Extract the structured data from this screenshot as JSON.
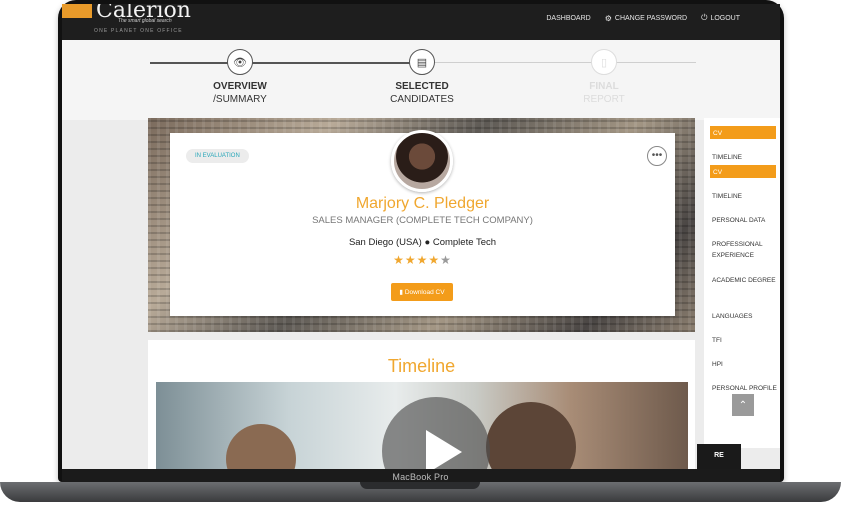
{
  "brand": {
    "logo_text": "Calerion",
    "tagline": "The smart global search",
    "subline": "ONE PLANET ONE OFFICE",
    "accent_color": "#f39c1a"
  },
  "nav": {
    "dashboard": "DASHBOARD",
    "change_password": "CHANGE PASSWORD",
    "logout": "LOGOUT"
  },
  "steps": [
    {
      "title": "OVERVIEW",
      "sub": "/SUMMARY",
      "icon": "eye-icon",
      "state": "done"
    },
    {
      "title": "SELECTED",
      "sub": "CANDIDATES",
      "icon": "list-icon",
      "state": "current"
    },
    {
      "title": "FINAL",
      "sub": "REPORT",
      "icon": "document-icon",
      "state": "pending"
    }
  ],
  "candidate": {
    "status": "IN EVALUATION",
    "name": "Marjory C. Pledger",
    "role": "SALES MANAGER (COMPLETE TECH COMPANY)",
    "location": "San Diego (USA)",
    "company": "Complete Tech",
    "rating": 4,
    "rating_max": 5,
    "download_label": "Download CV"
  },
  "side_nav": {
    "items": [
      {
        "label": "CV",
        "active": true
      },
      {
        "label": "TIMELINE",
        "active": false
      },
      {
        "label": "CV",
        "active": true
      },
      {
        "label": "TIMELINE",
        "active": false
      },
      {
        "label": "PERSONAL DATA",
        "active": false
      },
      {
        "label": "PROFESSIONAL EXPERIENCE",
        "active": false
      },
      {
        "label": "ACADEMIC DEGREE",
        "active": false
      },
      {
        "label": "LANGUAGES",
        "active": false
      },
      {
        "label": "TFI",
        "active": false
      },
      {
        "label": "HPI",
        "active": false
      },
      {
        "label": "PERSONAL PROFILE",
        "active": false
      }
    ]
  },
  "dark_tab_label": "RE",
  "timeline": {
    "title": "Timeline"
  },
  "device_label": "MacBook Pro"
}
